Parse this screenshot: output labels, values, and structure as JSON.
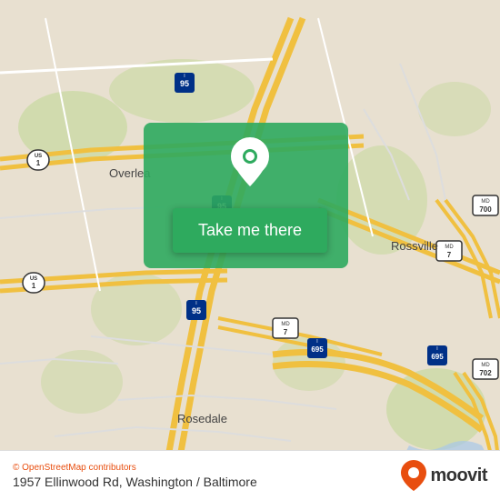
{
  "map": {
    "alt": "Street map of Baltimore/Washington area showing 1957 Ellinwood Rd"
  },
  "button": {
    "label": "Take me there"
  },
  "info_bar": {
    "attribution": "© OpenStreetMap contributors",
    "address": "1957 Ellinwood Rd, Washington / Baltimore",
    "moovit_label": "moovit"
  }
}
